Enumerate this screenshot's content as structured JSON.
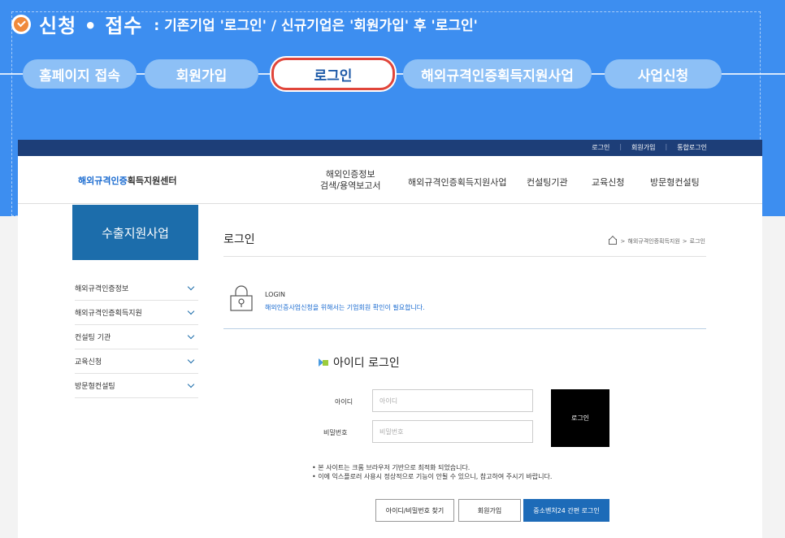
{
  "banner": {
    "title": "신청 • 접수",
    "subtitle": ": 기존기업 '로그인' / 신규기업은 '회원가입' 후 '로그인'",
    "steps": [
      "홈페이지 접속",
      "회원가입",
      "로그인",
      "해외규격인증획득지원사업",
      "사업신청"
    ],
    "active_step": 2
  },
  "site": {
    "top_links": [
      "로그인",
      "회원가입",
      "통합로그인"
    ],
    "logo_accent": "해외규격인증",
    "logo_rest": "획득지원센터",
    "nav": {
      "info_line1": "해외인증정보",
      "info_line2": "검색/용역보고서",
      "support": "해외규격인증획득지원사업",
      "consulting": "컨설팅기관",
      "education": "교육신청",
      "visit": "방문형컨설팅"
    }
  },
  "sidebar": {
    "title": "수출지원사업",
    "items": [
      "해외규격인증정보",
      "해외규격인증획득지원",
      "컨설팅 기관",
      "교육신청",
      "방문형컨설팅"
    ]
  },
  "main": {
    "page_title": "로그인",
    "breadcrumb": [
      "해외규격인증획득지원",
      "로그인"
    ],
    "login_heading": "LOGIN",
    "login_desc": "해외인증사업신청을 위해서는 기업회원 확인이 필요합니다.",
    "id_login_title": "아이디 로그인",
    "id_label": "아이디",
    "id_placeholder": "아이디",
    "pw_label": "비밀번호",
    "pw_placeholder": "비밀번호",
    "login_button": "로그인",
    "notes": [
      "• 본 사이트는 크롬 브라우저 기반으로 최적화 되었습니다.",
      "• 이에 익스플로러 사용시 정상적으로 기능이 안될 수 있으니, 참고하여 주시기 바랍니다."
    ],
    "find_button": "아이디/비밀번호 찾기",
    "join_button": "회원가입",
    "sme_button": "중소벤처24 간편 로그인"
  },
  "colors": {
    "banner_blue": "#3d8ef0",
    "navy": "#1d3e78",
    "primary": "#1c6dab",
    "accent_red": "#e0453a",
    "check_orange": "#f08a3c"
  }
}
